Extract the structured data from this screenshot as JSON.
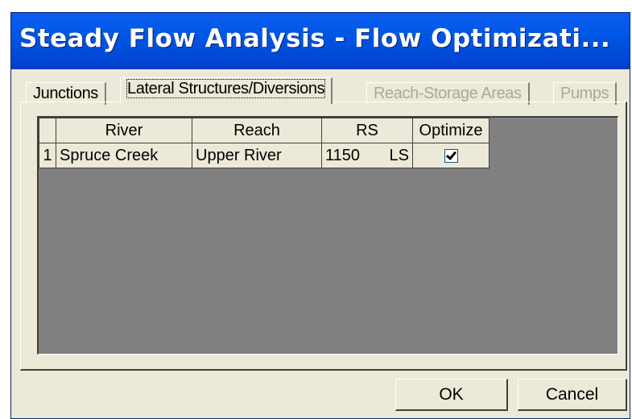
{
  "window": {
    "title": "Steady Flow Analysis - Flow Optimizati..."
  },
  "tabs": [
    {
      "label": "Junctions",
      "state": "normal"
    },
    {
      "label": "Lateral Structures/Diversions",
      "state": "active"
    },
    {
      "label": "Reach-Storage Areas",
      "state": "disabled"
    },
    {
      "label": "Pumps",
      "state": "disabled"
    }
  ],
  "table": {
    "columns": [
      "River",
      "Reach",
      "RS",
      "Optimize"
    ],
    "rows": [
      {
        "num": "1",
        "river": "Spruce Creek",
        "reach": "Upper River",
        "rs": "1150",
        "rs_type": "LS",
        "optimize": true
      }
    ]
  },
  "buttons": {
    "ok": "OK",
    "cancel": "Cancel"
  }
}
